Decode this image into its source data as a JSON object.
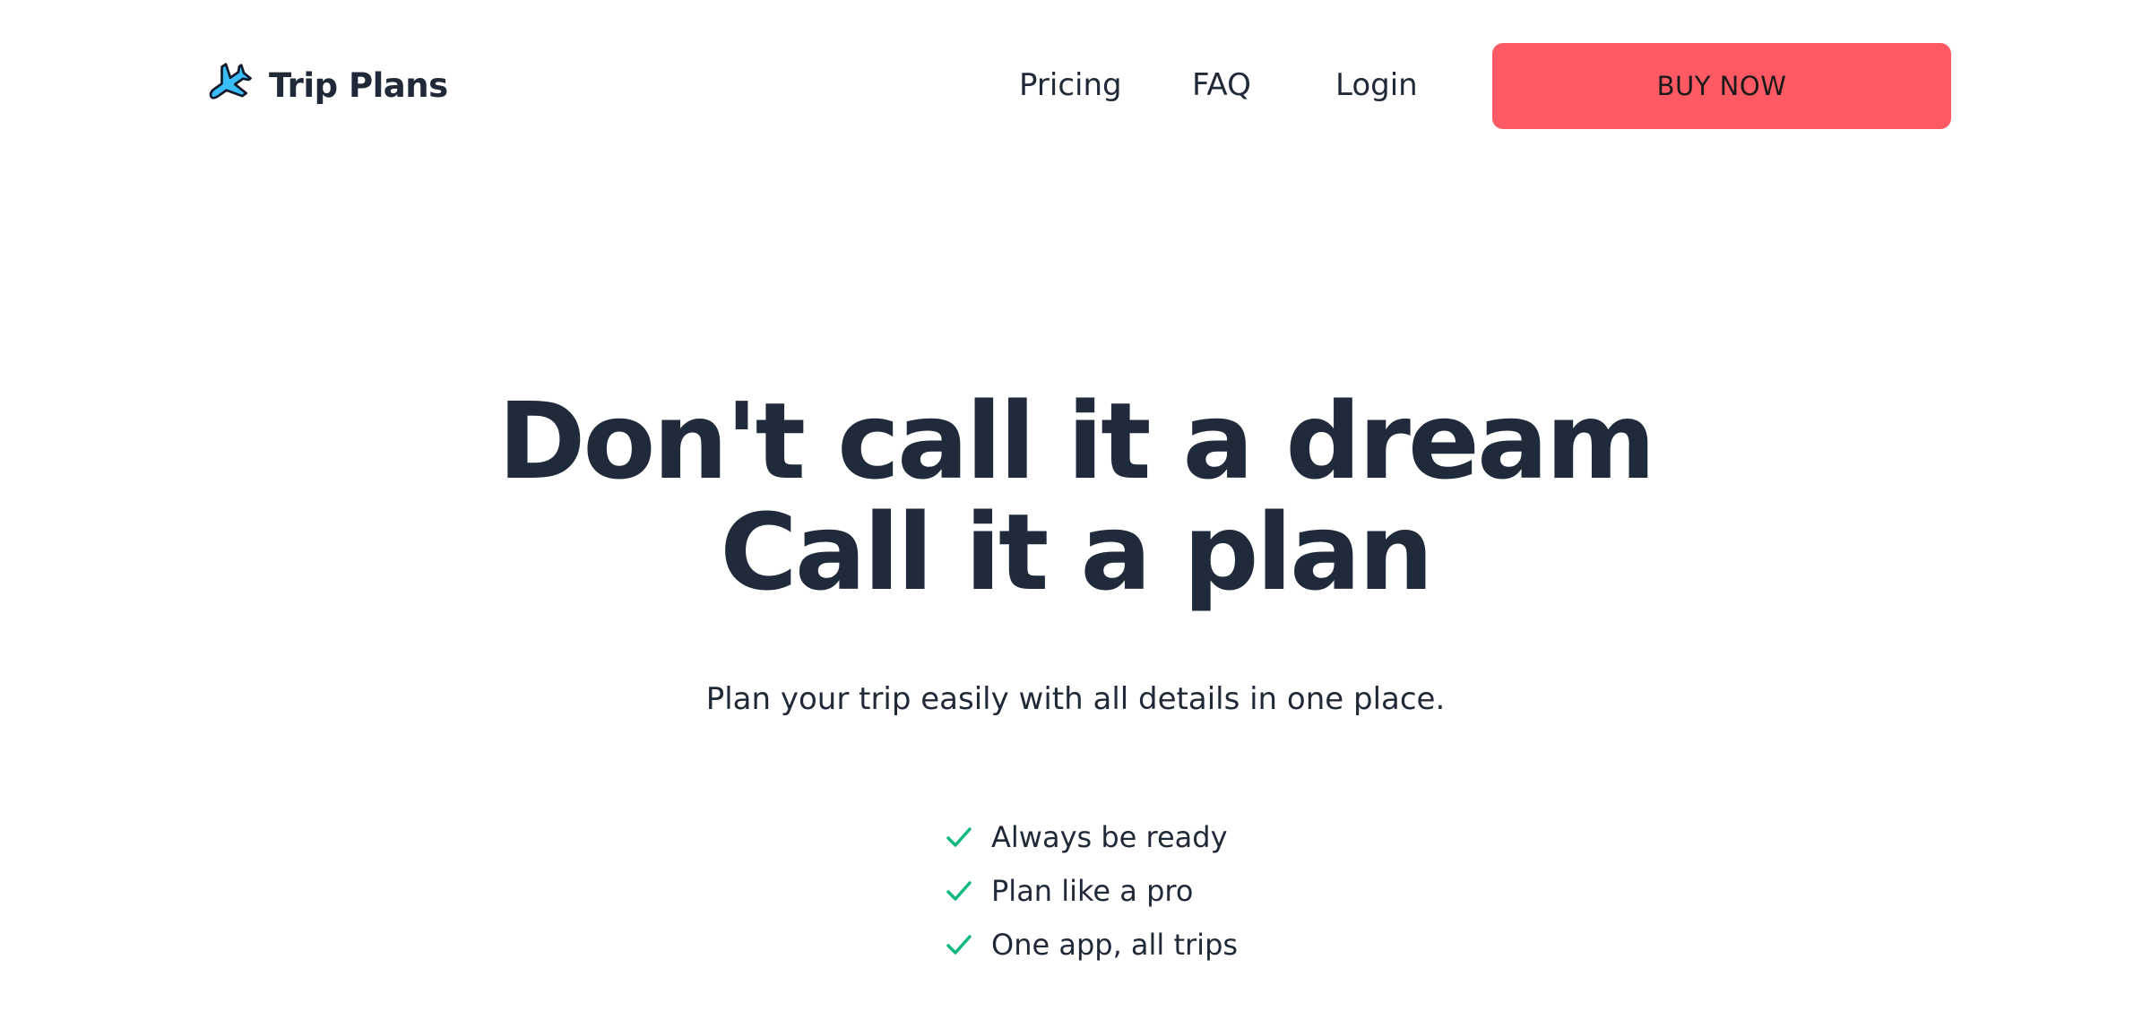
{
  "header": {
    "brand_name": "Trip Plans",
    "brand_icon": "airplane-icon",
    "nav": {
      "pricing": "Pricing",
      "faq": "FAQ",
      "login": "Login"
    },
    "buy_button": "BUY NOW"
  },
  "hero": {
    "title_line_1": "Don't call it a dream",
    "title_line_2": "Call it a plan",
    "subtitle": "Plan your trip easily with all details in one place.",
    "features": [
      "Always be ready",
      "Plan like a pro",
      "One app, all trips"
    ]
  },
  "colors": {
    "accent": "#ff5a64",
    "text": "#1f2937",
    "check": "#10b981",
    "icon": "#38bdf8"
  }
}
